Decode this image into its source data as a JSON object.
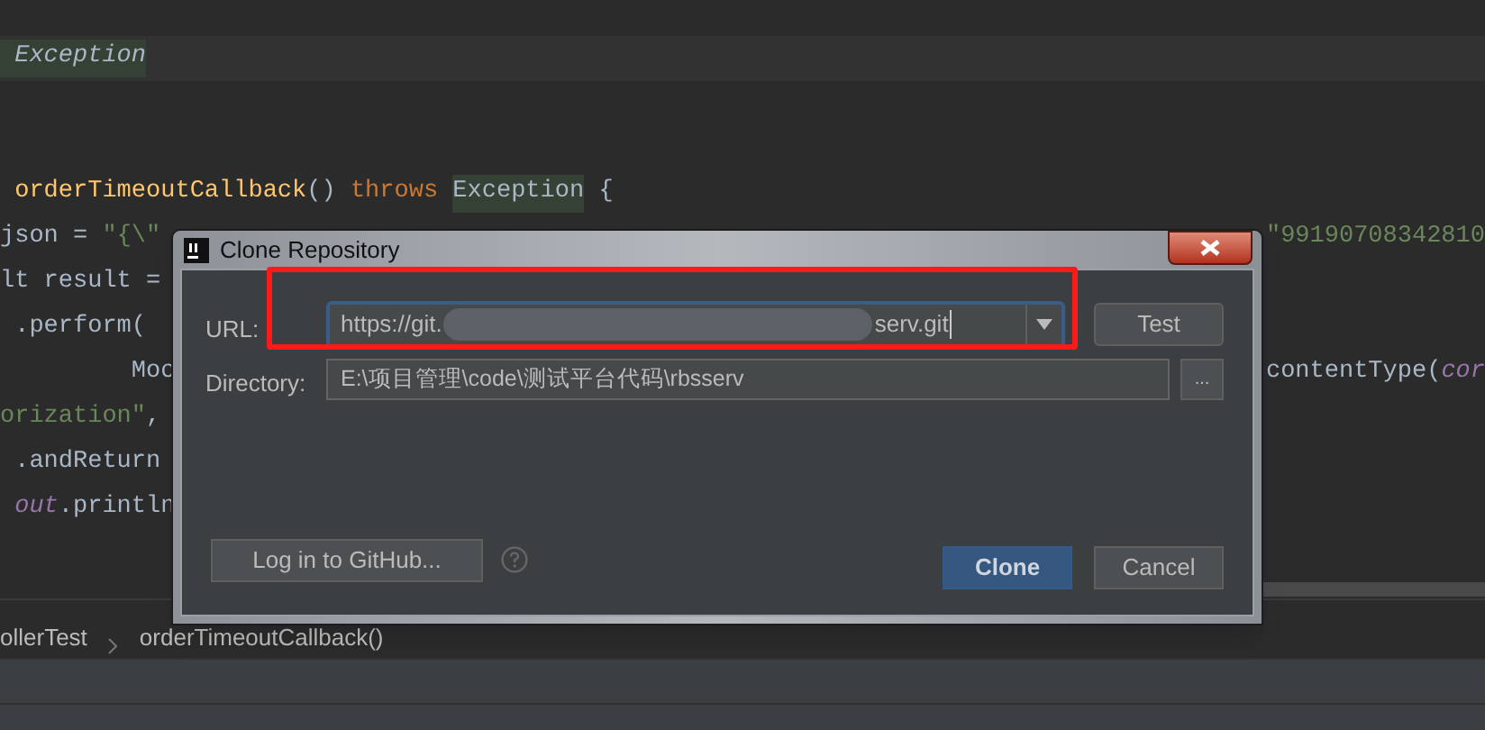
{
  "current_line": [
    {
      "text": " Exception",
      "kind": "italic-type"
    }
  ],
  "code_lines": [
    {
      "left": [
        {
          "text": " orderTimeoutCallback",
          "kind": "method"
        },
        {
          "text": "() ",
          "kind": "plain"
        },
        {
          "text": "throws ",
          "kind": "keyword"
        },
        {
          "text": "Exception",
          "kind": "type"
        },
        {
          "text": " {",
          "kind": "plain"
        }
      ]
    },
    {
      "left": [
        {
          "text": "json = ",
          "kind": "plain"
        },
        {
          "text": "\"{\\\"",
          "kind": "string"
        }
      ],
      "right": [
        {
          "text": "\"99190708342810",
          "kind": "string"
        }
      ]
    },
    {
      "left": [
        {
          "text": "lt result =",
          "kind": "plain"
        }
      ]
    },
    {
      "left": [
        {
          "text": " .perform(",
          "kind": "plain"
        }
      ]
    },
    {
      "left": [
        {
          "text": "         Moc",
          "kind": "plain"
        }
      ],
      "right": [
        {
          "text": "contentType(",
          "kind": "plain"
        },
        {
          "text": "cor",
          "kind": "field"
        }
      ]
    },
    {
      "left": [
        {
          "text": "orization\"",
          "kind": "string"
        },
        {
          "text": ",",
          "kind": "plain"
        }
      ]
    },
    {
      "left": [
        {
          "text": " .andReturn",
          "kind": "plain"
        }
      ]
    },
    {
      "left": [
        {
          "text": " out",
          "kind": "field"
        },
        {
          "text": ".println",
          "kind": "plain"
        }
      ]
    }
  ],
  "breadcrumbs": [
    "ollerTest",
    "orderTimeoutCallback()"
  ],
  "dialog": {
    "title": "Clone Repository",
    "url_label": "URL:",
    "url_start": "https://git.",
    "url_end": "serv.git",
    "test_button": "Test",
    "directory_label": "Directory:",
    "directory_value": "E:\\项目管理\\code\\测试平台代码\\rbsserv",
    "browse_button": "...",
    "login_button": "Log in to GitHub...",
    "clone_button": "Clone",
    "cancel_button": "Cancel"
  }
}
